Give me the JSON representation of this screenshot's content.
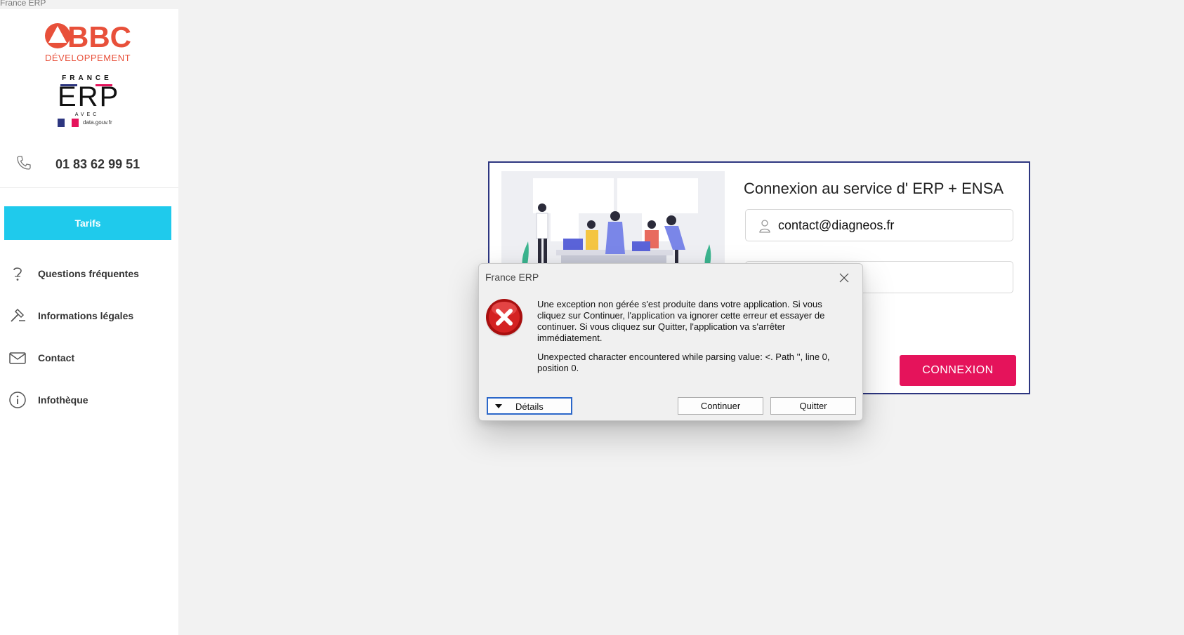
{
  "window": {
    "title": "France ERP"
  },
  "sidebar": {
    "logo_bbc": "BBC",
    "logo_bbc_sub": "DÉVELOPPEMENT",
    "logo_erp": {
      "top": "FRANCE",
      "main": "ERP",
      "avec": "AVEC",
      "data": "data.gouv.fr"
    },
    "phone": "01 83 62 99 51",
    "primary": "Tarifs",
    "items": [
      {
        "label": "Questions fréquentes",
        "icon": "question-icon"
      },
      {
        "label": "Informations légales",
        "icon": "gavel-icon"
      },
      {
        "label": "Contact",
        "icon": "mail-icon"
      },
      {
        "label": "Infothèque",
        "icon": "info-icon"
      }
    ]
  },
  "login": {
    "title": "Connexion au service d' ERP + ENSA",
    "email_value": "contact@diagneos.fr",
    "password_value": "",
    "button": "CONNEXION"
  },
  "dialog": {
    "title": "France ERP",
    "message1": "Une exception non gérée s'est produite dans votre application. Si vous cliquez sur Continuer, l'application va ignorer cette erreur et essayer de continuer. Si vous cliquez sur Quitter, l'application va s'arrêter immédiatement.",
    "message2": "Unexpected character encountered while parsing value: <. Path '', line 0, position 0.",
    "details": "Détails",
    "continue": "Continuer",
    "quit": "Quitter"
  },
  "colors": {
    "accent_cyan": "#1fcaec",
    "connexion_pink": "#e5135b",
    "card_border": "#2d3680",
    "bbc_red": "#e8503a"
  }
}
